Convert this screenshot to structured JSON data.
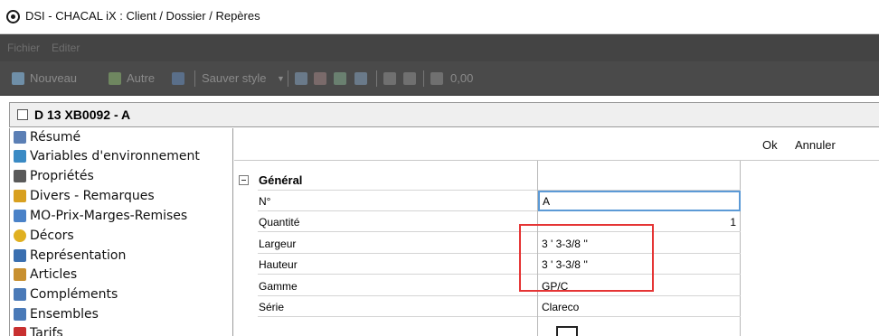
{
  "window": {
    "title": "DSI - CHACAL iX : Client / Dossier / Repères"
  },
  "menu": [
    "Fichier",
    "Editer"
  ],
  "toolbar": {
    "new_label": "Nouveau",
    "other_label": "Autre",
    "save_style_label": "Sauver style",
    "total_value": "0,00"
  },
  "document": {
    "title": "D 13 XB0092 -  A"
  },
  "nav": {
    "items": [
      {
        "label": "Résumé",
        "icon": "summary-icon",
        "color": "#5b7fb5"
      },
      {
        "label": "Variables d'environnement",
        "icon": "environment-icon",
        "color": "#3a8ac4"
      },
      {
        "label": "Propriétés",
        "icon": "properties-icon",
        "color": "#5a5a5a"
      },
      {
        "label": "Divers - Remarques",
        "icon": "notes-icon",
        "color": "#d8a020"
      },
      {
        "label": "MO-Prix-Marges-Remises",
        "icon": "price-icon",
        "color": "#4a82c8"
      },
      {
        "label": "Décors",
        "icon": "decor-icon",
        "color": "#e0b020"
      },
      {
        "label": "Représentation",
        "icon": "drawing-icon",
        "color": "#3a6fb0"
      },
      {
        "label": "Articles",
        "icon": "articles-icon",
        "color": "#c89030"
      },
      {
        "label": "Compléments",
        "icon": "complements-icon",
        "color": "#4a7ab8"
      },
      {
        "label": "Ensembles",
        "icon": "assembly-icon",
        "color": "#4a7ab8"
      },
      {
        "label": "Tarifs",
        "icon": "tariffs-icon",
        "color": "#c83030"
      }
    ]
  },
  "actions": {
    "ok_label": "Ok",
    "cancel_label": "Annuler"
  },
  "properties": {
    "group_label": "Général",
    "rows": [
      {
        "name": "N°",
        "value": "A"
      },
      {
        "name": "Quantité",
        "value": "1"
      },
      {
        "name": "Largeur",
        "value": "3 ' 3-3/8 ''"
      },
      {
        "name": "Hauteur",
        "value": "3 ' 3-3/8 ''"
      },
      {
        "name": "Gamme",
        "value": "GP/C"
      },
      {
        "name": "Série",
        "value": "Clareco"
      }
    ]
  },
  "annotation": {
    "color": "#e53535"
  }
}
